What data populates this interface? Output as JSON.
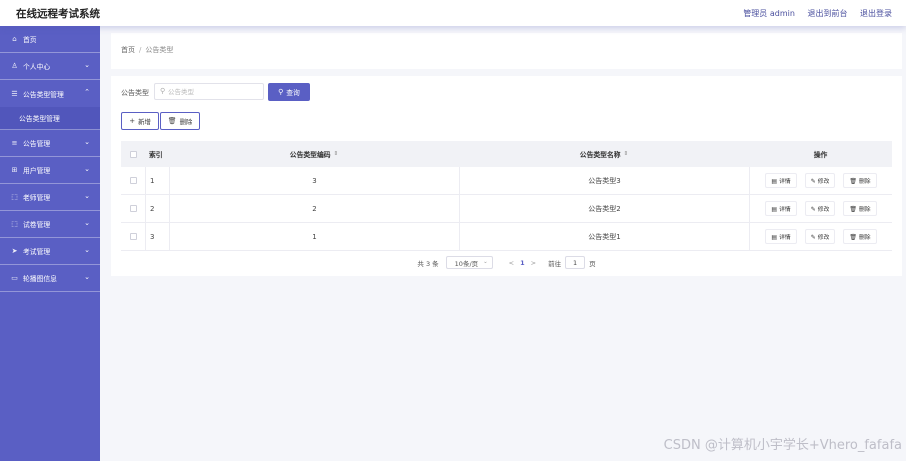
{
  "header": {
    "app_title": "在线远程考试系统",
    "links": [
      "管理员 admin",
      "退出到前台",
      "退出登录"
    ]
  },
  "sidebar": {
    "items": [
      {
        "label": "首页",
        "icon": "home-icon"
      },
      {
        "label": "个人中心",
        "icon": "user-icon"
      },
      {
        "label": "公告类型管理",
        "icon": "list-icon",
        "expanded": true,
        "sub": "公告类型管理"
      },
      {
        "label": "公告管理",
        "icon": "menu-icon"
      },
      {
        "label": "用户管理",
        "icon": "grid-icon"
      },
      {
        "label": "老师管理",
        "icon": "frame-icon"
      },
      {
        "label": "试卷管理",
        "icon": "frame-icon"
      },
      {
        "label": "考试管理",
        "icon": "send-icon"
      },
      {
        "label": "轮播图信息",
        "icon": "image-icon"
      }
    ]
  },
  "breadcrumb": {
    "home": "首页",
    "sep": "/",
    "current": "公告类型"
  },
  "search": {
    "label": "公告类型",
    "placeholder": "公告类型",
    "button": "查询"
  },
  "actions": {
    "add": "新增",
    "delete": "删除"
  },
  "table": {
    "headers": {
      "index": "索引",
      "code": "公告类型编码",
      "name": "公告类型名称",
      "ops": "操作"
    },
    "ops": {
      "detail": "详情",
      "edit": "修改",
      "delete": "删除"
    },
    "rows": [
      {
        "index": "1",
        "code": "3",
        "name": "公告类型3"
      },
      {
        "index": "2",
        "code": "2",
        "name": "公告类型2"
      },
      {
        "index": "3",
        "code": "1",
        "name": "公告类型1"
      }
    ]
  },
  "pagination": {
    "total": "共 3 条",
    "page_size": "10条/页",
    "prev": "<",
    "current_page": "1",
    "next": ">",
    "goto_label": "前往",
    "goto_value": "1",
    "page_suffix": "页"
  },
  "watermark": "CSDN @计算机小宇学长+Vhero_fafafa",
  "colors": {
    "accent": "#5a5fc4",
    "sidebar": "#5a5fc4"
  }
}
